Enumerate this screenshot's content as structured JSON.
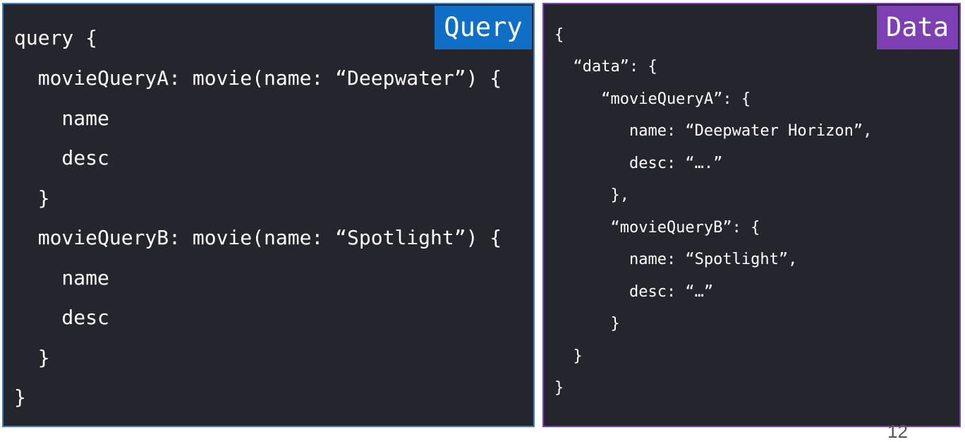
{
  "query_panel": {
    "badge": "Query",
    "lines": [
      "query {",
      "  movieQueryA: movie(name: “Deepwater”) {",
      "    name",
      "    desc",
      "  }",
      "  movieQueryB: movie(name: “Spotlight”) {",
      "    name",
      "    desc",
      "  }",
      "}"
    ]
  },
  "data_panel": {
    "badge": "Data",
    "lines": [
      "{",
      "  “data”: {",
      "     “movieQueryA”: {",
      "        name: “Deepwater Horizon”,",
      "        desc: “….”",
      "      },",
      "      “movieQueryB”: {",
      "        name: “Spotlight”,",
      "        desc: “…”",
      "      }",
      "  }",
      "}"
    ]
  },
  "page_number": "12",
  "colors": {
    "panel_background": "#25252d",
    "query_accent": "#0f6fc6",
    "data_accent": "#7d3fb3",
    "text": "#ffffff"
  }
}
